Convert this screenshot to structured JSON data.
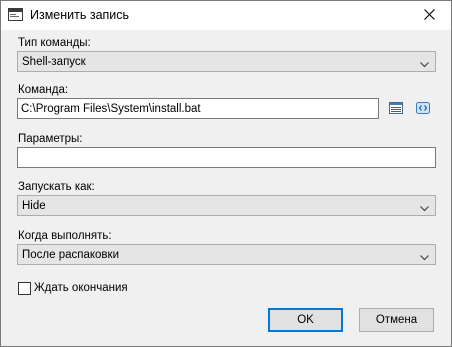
{
  "window": {
    "title": "Изменить запись",
    "icons": {
      "app": "window-icon",
      "close": "close-icon"
    }
  },
  "form": {
    "command_type": {
      "label": "Тип команды:",
      "value": "Shell-запуск"
    },
    "command": {
      "label": "Команда:",
      "value": "C:\\Program Files\\System\\install.bat",
      "icons": [
        "browse-file-icon",
        "variables-icon"
      ]
    },
    "parameters": {
      "label": "Параметры:",
      "value": ""
    },
    "run_as": {
      "label": "Запускать как:",
      "value": "Hide"
    },
    "when": {
      "label": "Когда выполнять:",
      "value": "После распаковки"
    },
    "wait": {
      "label": "Ждать окончания",
      "checked": false
    }
  },
  "buttons": {
    "ok": "OK",
    "cancel": "Отмена"
  },
  "colors": {
    "accent": "#0078d7",
    "dialog_bg": "#f0f0f0",
    "combo_bg": "#e5e5e5"
  }
}
